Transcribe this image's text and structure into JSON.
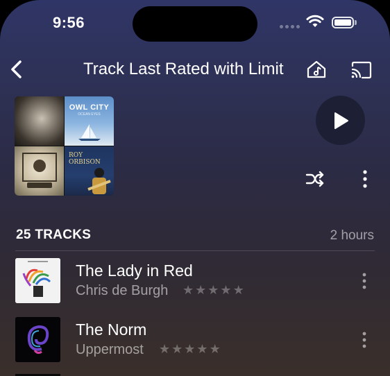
{
  "status_bar": {
    "time": "9:56"
  },
  "header": {
    "title": "Track Last Rated with Limit",
    "back_icon": "chevron-left-icon",
    "home_icon": "home-music-icon",
    "cast_icon": "cast-icon"
  },
  "artwork": {
    "owl_city": "OWL CITY",
    "owl_city_sub": "OCEAN EYES",
    "roy_orbison": "ROY ORBISON"
  },
  "summary": {
    "tracks_label": "25 TRACKS",
    "duration": "2 hours"
  },
  "tracks": [
    {
      "title": "The Lady in Red",
      "artist": "Chris de Burgh",
      "rating": 0,
      "max_rating": 5
    },
    {
      "title": "The Norm",
      "artist": "Uppermost",
      "rating": 0,
      "max_rating": 5
    }
  ],
  "colors": {
    "play_button_bg": "#1d2034",
    "star_inactive": "#ffffff4d"
  }
}
